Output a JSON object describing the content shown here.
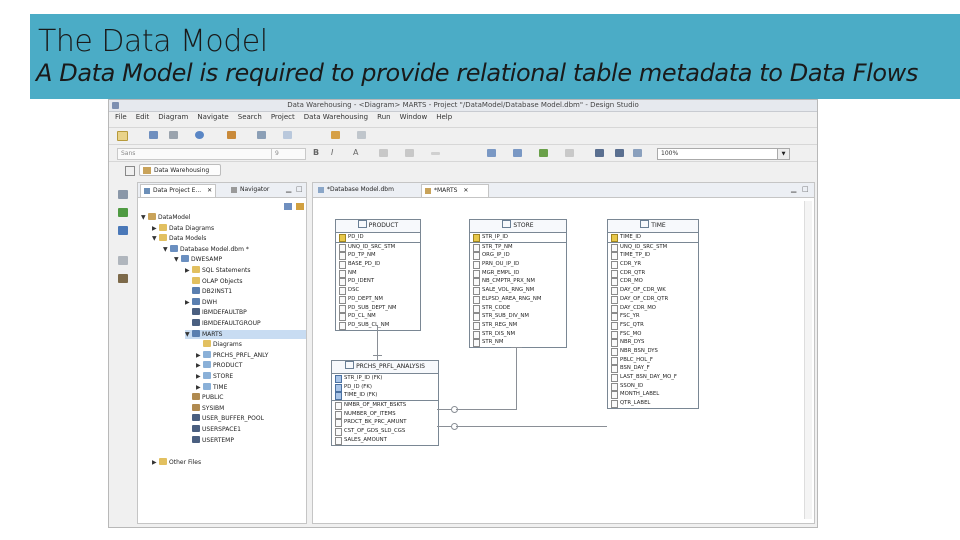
{
  "slide": {
    "title": "The Data Model",
    "subtitle": "A Data Model is required to provide relational table metadata to Data Flows"
  },
  "window": {
    "title": "Data Warehousing - <Diagram> MARTS - Project \"/DataModel/Database Model.dbm\" - Design Studio"
  },
  "menu": [
    "File",
    "Edit",
    "Diagram",
    "Navigate",
    "Search",
    "Project",
    "Data Warehousing",
    "Run",
    "Window",
    "Help"
  ],
  "toolbar": {
    "font_value": "Sans",
    "size_value": "9",
    "zoom_value": "100%"
  },
  "perspective": {
    "tab_label": "Data Warehousing"
  },
  "explorer": {
    "tabs": [
      "Data Project E...",
      "Navigator"
    ],
    "tree": [
      {
        "label": "DataModel",
        "depth": 0,
        "toggle": "▼",
        "icon": "project"
      },
      {
        "label": "Data Diagrams",
        "depth": 1,
        "toggle": "▶",
        "icon": "folder"
      },
      {
        "label": "Data Models",
        "depth": 1,
        "toggle": "▼",
        "icon": "folder"
      },
      {
        "label": "Database Model.dbm *",
        "depth": 2,
        "toggle": "▼",
        "icon": "db"
      },
      {
        "label": "DWESAMP",
        "depth": 3,
        "toggle": "▼",
        "icon": "db"
      },
      {
        "label": "SQL Statements",
        "depth": 4,
        "toggle": "▶",
        "icon": "folder"
      },
      {
        "label": "OLAP Objects",
        "depth": 4,
        "toggle": "",
        "icon": "folder"
      },
      {
        "label": "DB2INST1",
        "depth": 4,
        "toggle": "",
        "icon": "schema"
      },
      {
        "label": "DWH",
        "depth": 4,
        "toggle": "▶",
        "icon": "schema"
      },
      {
        "label": "IBMDEFAULTBP",
        "depth": 4,
        "toggle": "",
        "icon": "bp"
      },
      {
        "label": "IBMDEFAULTGROUP",
        "depth": 4,
        "toggle": "",
        "icon": "bp"
      },
      {
        "label": "MARTS",
        "depth": 4,
        "toggle": "▼",
        "icon": "schema",
        "selected": true
      },
      {
        "label": "Diagrams",
        "depth": 5,
        "toggle": "",
        "icon": "folder"
      },
      {
        "label": "PRCHS_PRFL_ANLY",
        "depth": 5,
        "toggle": "▶",
        "icon": "table"
      },
      {
        "label": "PRODUCT",
        "depth": 5,
        "toggle": "▶",
        "icon": "table"
      },
      {
        "label": "STORE",
        "depth": 5,
        "toggle": "▶",
        "icon": "table"
      },
      {
        "label": "TIME",
        "depth": 5,
        "toggle": "▶",
        "icon": "table"
      },
      {
        "label": "PUBLIC",
        "depth": 4,
        "toggle": "",
        "icon": "user"
      },
      {
        "label": "SYSIBM",
        "depth": 4,
        "toggle": "",
        "icon": "user"
      },
      {
        "label": "USER_BUFFER_POOL",
        "depth": 4,
        "toggle": "",
        "icon": "bp"
      },
      {
        "label": "USERSPACE1",
        "depth": 4,
        "toggle": "",
        "icon": "bp"
      },
      {
        "label": "USERTEMP",
        "depth": 4,
        "toggle": "",
        "icon": "bp"
      },
      {
        "label": "Other Files",
        "depth": 1,
        "toggle": "▶",
        "icon": "folder"
      }
    ]
  },
  "editor": {
    "tabs": [
      "*Database Model.dbm",
      "*MARTS"
    ],
    "entities": [
      {
        "name": "PRODUCT",
        "pk": [
          "PD_ID"
        ],
        "columns": [
          "UNQ_ID_SRC_STM",
          "PD_TP_NM",
          "BASE_PD_ID",
          "NM",
          "PD_IDENT",
          "DSC",
          "PD_DEPT_NM",
          "PD_SUB_DEPT_NM",
          "PD_CL_NM",
          "PD_SUB_CL_NM"
        ]
      },
      {
        "name": "STORE",
        "pk": [
          "STR_IP_ID"
        ],
        "columns": [
          "STR_TP_NM",
          "ORG_IP_ID",
          "PRN_OU_IP_ID",
          "MGR_EMPL_ID",
          "NB_CMPTR_PRX_NM",
          "SALE_VOL_RNG_NM",
          "ELPSD_AREA_RNG_NM",
          "STR_CODE",
          "STR_SUB_DIV_NM",
          "STR_REG_NM",
          "STR_DIS_NM",
          "STR_NM"
        ]
      },
      {
        "name": "TIME",
        "pk": [
          "TIME_ID"
        ],
        "columns": [
          "UNQ_ID_SRC_STM",
          "TIME_TP_ID",
          "CDR_YR",
          "CDR_QTR",
          "CDR_MO",
          "DAY_OF_CDR_WK",
          "DAY_OF_CDR_QTR",
          "DAY_CDR_MO",
          "FSC_YR",
          "FSC_QTR",
          "FSC_MO",
          "NBR_DYS",
          "NBR_BSN_DYS",
          "PBLC_HOL_F",
          "BSN_DAY_F",
          "LAST_BSN_DAY_MO_F",
          "SSON_ID",
          "MONTH_LABEL",
          "QTR_LABEL"
        ]
      },
      {
        "name": "PRCHS_PRFL_ANALYSIS",
        "pk": [
          "STR_IP_ID (FK)",
          "PD_ID (FK)",
          "TIME_ID (FK)"
        ],
        "columns": [
          "NMBR_OF_MRKT_BSKTS",
          "NUMBER_OF_ITEMS",
          "PRDCT_BK_PRC_AMUNT",
          "CST_OF_GDS_SLD_CGS",
          "SALES_AMOUNT"
        ]
      }
    ]
  }
}
